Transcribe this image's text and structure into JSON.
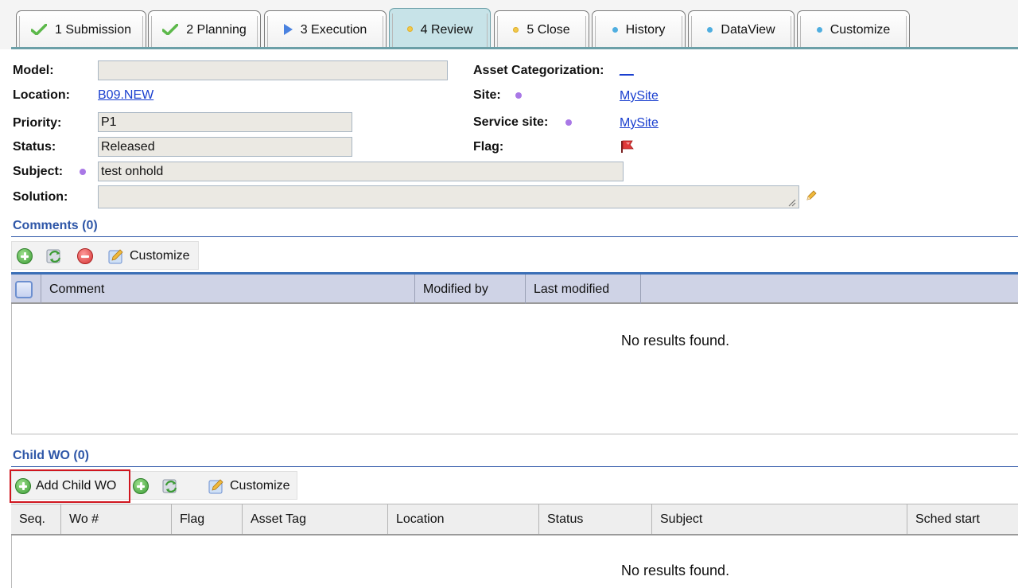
{
  "tabs": [
    {
      "label": "1 Submission",
      "icon": "check-icon"
    },
    {
      "label": "2 Planning",
      "icon": "check-icon"
    },
    {
      "label": "3 Execution",
      "icon": "play-icon"
    },
    {
      "label": "4 Review",
      "icon": "yellow-dot-icon",
      "active": true
    },
    {
      "label": "5 Close",
      "icon": "yellow-dot-icon"
    },
    {
      "label": "History",
      "icon": "blue-dot-icon"
    },
    {
      "label": "DataView",
      "icon": "blue-dot-icon"
    },
    {
      "label": "Customize",
      "icon": "blue-dot-icon"
    }
  ],
  "form": {
    "model_label": "Model:",
    "model_value": "",
    "location_label": "Location:",
    "location_value": "B09.NEW",
    "priority_label": "Priority:",
    "priority_value": "P1",
    "status_label": "Status:",
    "status_value": "Released",
    "subject_label": "Subject:",
    "subject_value": "test onhold",
    "solution_label": "Solution:",
    "solution_value": "",
    "asset_cat_label": "Asset Categorization:",
    "asset_cat_value": "__",
    "site_label": "Site:",
    "site_value": "MySite",
    "service_site_label": "Service site:",
    "service_site_value": "MySite",
    "flag_label": "Flag:"
  },
  "comments": {
    "title": "Comments (0)",
    "customize_label": "Customize",
    "columns": [
      "Comment",
      "Modified by",
      "Last modified"
    ],
    "empty_text": "No results found."
  },
  "child_wo": {
    "title": "Child WO (0)",
    "add_child_label": "Add Child WO",
    "customize_label": "Customize",
    "columns": [
      "Seq.",
      "Wo #",
      "Flag",
      "Asset Tag",
      "Location",
      "Status",
      "Subject",
      "Sched start"
    ],
    "empty_text": "No results found."
  },
  "colors": {
    "accent": "#2f57a8",
    "tab_active": "#c7e3e8",
    "field_bg": "#ebe9e3",
    "highlight": "#d0161f"
  }
}
